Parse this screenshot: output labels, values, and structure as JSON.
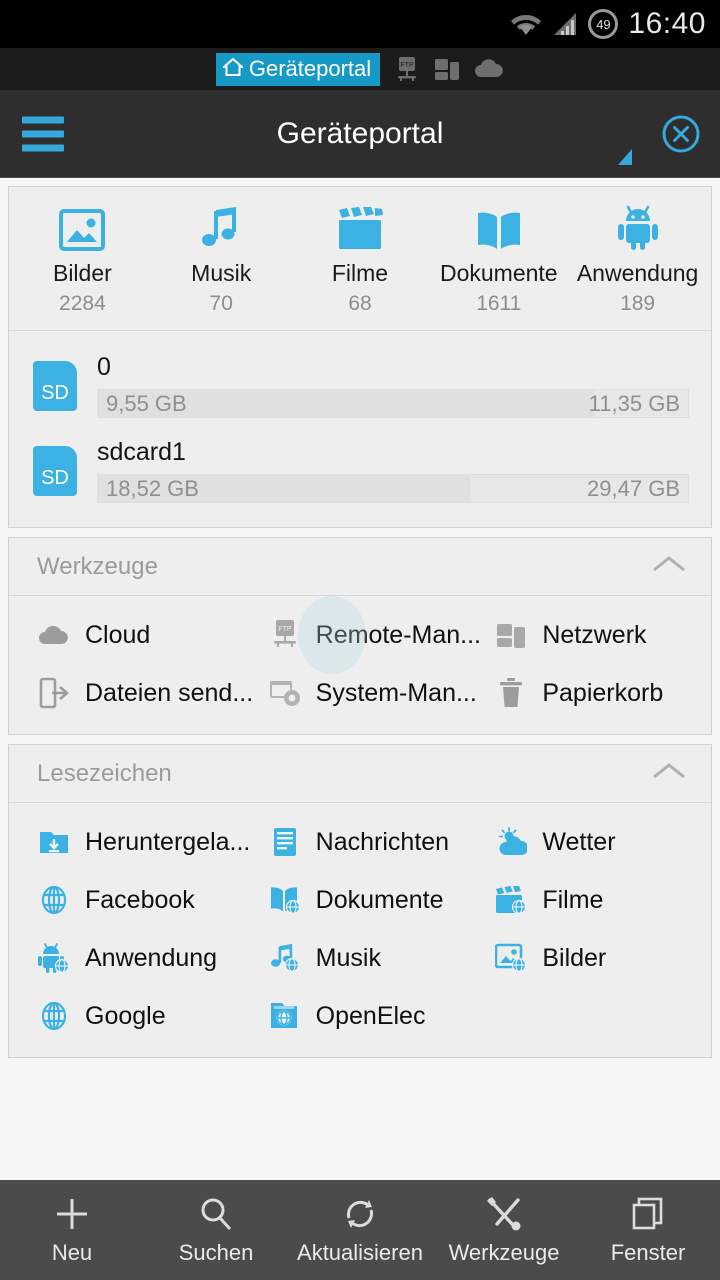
{
  "statusbar": {
    "wifi_icon": "wifi-icon",
    "signal_icon": "cellular-signal-icon",
    "battery_icon": "battery-icon",
    "battery_level": "49",
    "clock": "16:40"
  },
  "tabstrip": {
    "active_tab": {
      "label": "Geräteportal",
      "icon": "home-icon"
    },
    "tabs": [
      {
        "icon": "ftp-icon",
        "name": "ftp-tab"
      },
      {
        "icon": "network-devices-icon",
        "name": "network-tab"
      },
      {
        "icon": "cloud-icon",
        "name": "cloud-tab"
      }
    ]
  },
  "actionbar": {
    "menu_icon": "hamburger-menu-icon",
    "title": "Geräteportal",
    "close_icon": "close-circle-icon",
    "corner_marker": "resize-handle-icon",
    "accent_color": "#35a8dd"
  },
  "categories": [
    {
      "label": "Bilder",
      "count": "2284",
      "icon": "image-icon"
    },
    {
      "label": "Musik",
      "count": "70",
      "icon": "music-note-icon"
    },
    {
      "label": "Filme",
      "count": "68",
      "icon": "clapperboard-icon"
    },
    {
      "label": "Dokumente",
      "count": "1611",
      "icon": "book-icon"
    },
    {
      "label": "Anwendung",
      "count": "189",
      "icon": "android-robot-icon"
    }
  ],
  "storages": [
    {
      "name": "0",
      "icon": "sd-card-icon",
      "badge": "SD",
      "used": "9,55 GB",
      "total": "11,35 GB",
      "percent": 84
    },
    {
      "name": "sdcard1",
      "icon": "sd-card-icon",
      "badge": "SD",
      "used": "18,52 GB",
      "total": "29,47 GB",
      "percent": 63
    }
  ],
  "tools_section": {
    "title": "Werkzeuge",
    "collapse_icon": "chevron-up-icon",
    "items": [
      {
        "label": "Cloud",
        "icon": "cloud-icon"
      },
      {
        "label": "Remote-Man...",
        "icon": "ftp-remote-manager-icon"
      },
      {
        "label": "Netzwerk",
        "icon": "network-devices-icon"
      },
      {
        "label": "Dateien send...",
        "icon": "send-files-icon"
      },
      {
        "label": "System-Man...",
        "icon": "system-manager-icon"
      },
      {
        "label": "Papierkorb",
        "icon": "trash-icon"
      }
    ]
  },
  "bookmarks_section": {
    "title": "Lesezeichen",
    "collapse_icon": "chevron-up-icon",
    "items": [
      {
        "label": "Heruntergela...",
        "icon": "download-folder-icon"
      },
      {
        "label": "Nachrichten",
        "icon": "document-lines-icon"
      },
      {
        "label": "Wetter",
        "icon": "weather-cloud-sun-icon"
      },
      {
        "label": "Facebook",
        "icon": "globe-icon"
      },
      {
        "label": "Dokumente",
        "icon": "book-globe-icon"
      },
      {
        "label": "Filme",
        "icon": "clapperboard-globe-icon"
      },
      {
        "label": "Anwendung",
        "icon": "android-globe-icon"
      },
      {
        "label": "Musik",
        "icon": "music-globe-icon"
      },
      {
        "label": "Bilder",
        "icon": "image-globe-icon"
      },
      {
        "label": "Google",
        "icon": "globe-icon"
      },
      {
        "label": "OpenElec",
        "icon": "folder-globe-icon"
      }
    ]
  },
  "bottombar": [
    {
      "label": "Neu",
      "icon": "plus-icon"
    },
    {
      "label": "Suchen",
      "icon": "search-icon"
    },
    {
      "label": "Aktualisieren",
      "icon": "refresh-icon"
    },
    {
      "label": "Werkzeuge",
      "icon": "tools-icon"
    },
    {
      "label": "Fenster",
      "icon": "windows-icon"
    }
  ]
}
